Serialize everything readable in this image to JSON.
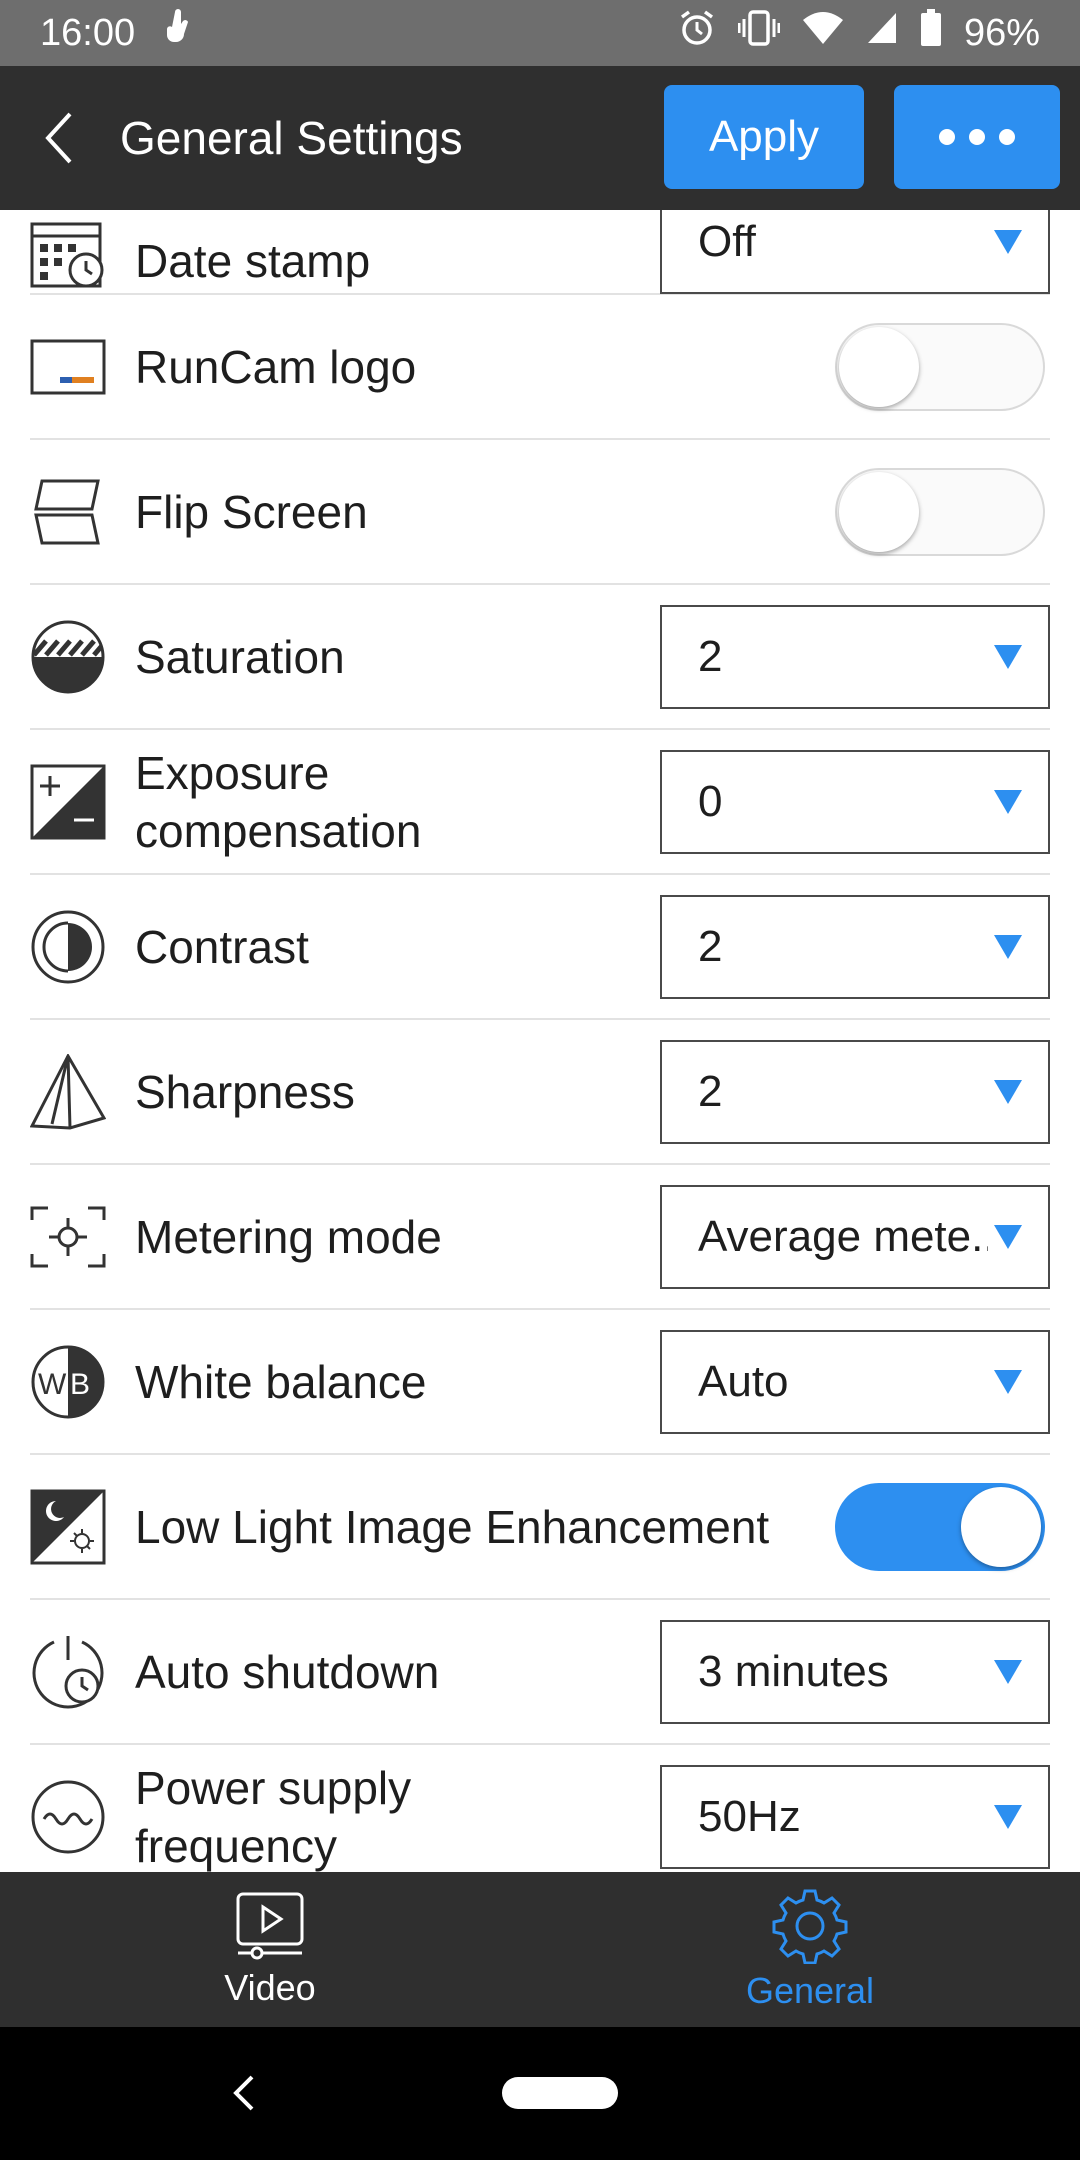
{
  "status_bar": {
    "time": "16:00",
    "battery": "96%",
    "icons": [
      "touch-icon",
      "alarm-icon",
      "vibrate-icon",
      "wifi-icon",
      "signal-icon",
      "battery-icon"
    ]
  },
  "header": {
    "title": "General Settings",
    "apply_label": "Apply",
    "more_icon": "more-icon",
    "back_icon": "back-arrow-icon"
  },
  "settings": {
    "date_stamp": {
      "label": "Date stamp",
      "value": "Off"
    },
    "runcam_logo": {
      "label": "RunCam logo",
      "enabled": false
    },
    "flip_screen": {
      "label": "Flip Screen",
      "enabled": false
    },
    "saturation": {
      "label": "Saturation",
      "value": "2"
    },
    "exposure": {
      "label_line1": "Exposure",
      "label_line2": "compensation",
      "value": "0"
    },
    "contrast": {
      "label": "Contrast",
      "value": "2"
    },
    "sharpness": {
      "label": "Sharpness",
      "value": "2"
    },
    "metering": {
      "label": "Metering mode",
      "value": "Average mete.."
    },
    "white_balance": {
      "label": "White balance",
      "value": "Auto"
    },
    "low_light": {
      "label": "Low Light Image Enhancement",
      "enabled": true
    },
    "auto_shutdown": {
      "label": "Auto shutdown",
      "value": "3 minutes"
    },
    "power_freq": {
      "label_line1": "Power supply",
      "label_line2": "frequency",
      "value": "50Hz"
    }
  },
  "bottom_nav": {
    "video_label": "Video",
    "general_label": "General",
    "active": "General"
  },
  "colors": {
    "accent": "#2d8ff0",
    "bar_dark": "#2f2f2f",
    "status_bar": "#6e6e6e"
  }
}
